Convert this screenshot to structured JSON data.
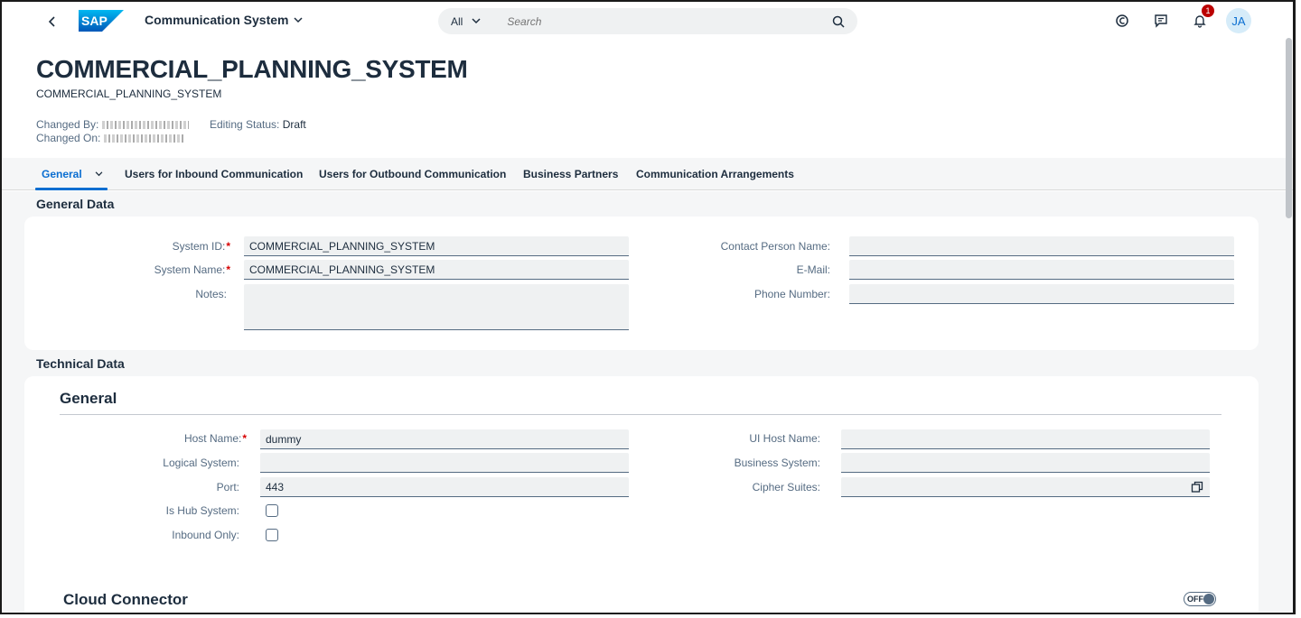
{
  "shell": {
    "app_title": "Communication System",
    "search_scope": "All",
    "search_placeholder": "Search",
    "notification_count": "1",
    "avatar_initials": "JA"
  },
  "header": {
    "title": "COMMERCIAL_PLANNING_SYSTEM",
    "subtitle": "COMMERCIAL_PLANNING_SYSTEM",
    "changed_by_label": "Changed By:",
    "changed_on_label": "Changed On:",
    "editing_status_label": "Editing Status:",
    "editing_status_value": "Draft"
  },
  "tabs": [
    {
      "label": "General"
    },
    {
      "label": "Users for Inbound Communication"
    },
    {
      "label": "Users for Outbound Communication"
    },
    {
      "label": "Business Partners"
    },
    {
      "label": "Communication Arrangements"
    }
  ],
  "general_data": {
    "section_title": "General Data",
    "system_id_label": "System ID:",
    "system_id_value": "COMMERCIAL_PLANNING_SYSTEM",
    "system_name_label": "System Name:",
    "system_name_value": "COMMERCIAL_PLANNING_SYSTEM",
    "notes_label": "Notes:",
    "notes_value": "",
    "contact_person_label": "Contact Person Name:",
    "contact_person_value": "",
    "email_label": "E-Mail:",
    "email_value": "",
    "phone_label": "Phone Number:",
    "phone_value": ""
  },
  "technical_data": {
    "section_title": "Technical Data",
    "general_title": "General",
    "host_name_label": "Host Name:",
    "host_name_value": "dummy",
    "logical_system_label": "Logical System:",
    "logical_system_value": "",
    "port_label": "Port:",
    "port_value": "443",
    "is_hub_label": "Is Hub System:",
    "is_hub_checked": false,
    "inbound_only_label": "Inbound Only:",
    "inbound_only_checked": false,
    "ui_host_label": "UI Host Name:",
    "ui_host_value": "",
    "business_system_label": "Business System:",
    "business_system_value": "",
    "cipher_suites_label": "Cipher Suites:",
    "cipher_suites_value": "",
    "cloud_connector_title": "Cloud Connector",
    "cloud_connector_switch": "OFF"
  },
  "colors": {
    "accent": "#0a6ed1",
    "required": "#d70000",
    "field_bg": "#eff1f2",
    "page_bg": "#f5f6f7"
  }
}
